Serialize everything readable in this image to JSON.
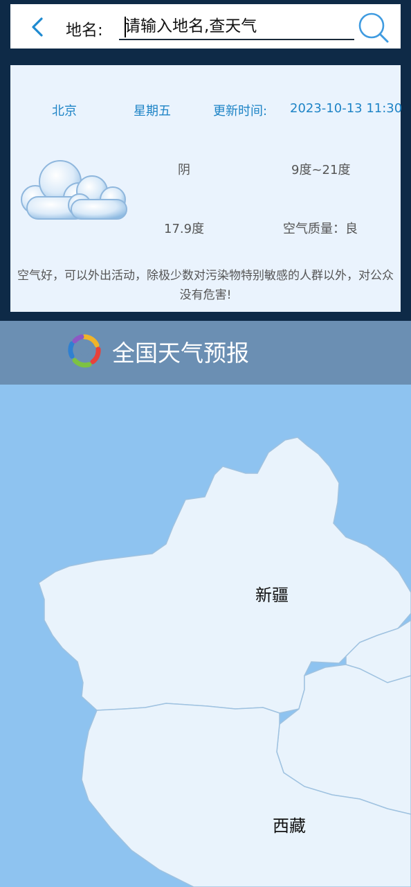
{
  "search": {
    "label": "地名:",
    "placeholder": "请输入地名,查天气"
  },
  "weather": {
    "city": "北京",
    "weekday": "星期五",
    "update_label": "更新时间:",
    "update_time": "2023-10-13 11:30",
    "condition": "阴",
    "temp_range": "9度~21度",
    "current_temp": "17.9度",
    "air_quality": "空气质量：良",
    "advice": "空气好，可以外出活动，除极少数对污染物特别敏感的人群以外，对公众没有危害!",
    "icon": "cloudy-icon"
  },
  "forecast": {
    "title": "全国天气预报",
    "logo": "weather-logo-icon"
  },
  "map": {
    "regions": [
      "新疆",
      "西藏"
    ]
  },
  "colors": {
    "background": "#0e2a47",
    "card": "#eaf3fd",
    "accent": "#1e84c6",
    "header_band": "#6b8fb3",
    "map_water": "#8ec3f0",
    "map_land": "#e9f3fc"
  }
}
